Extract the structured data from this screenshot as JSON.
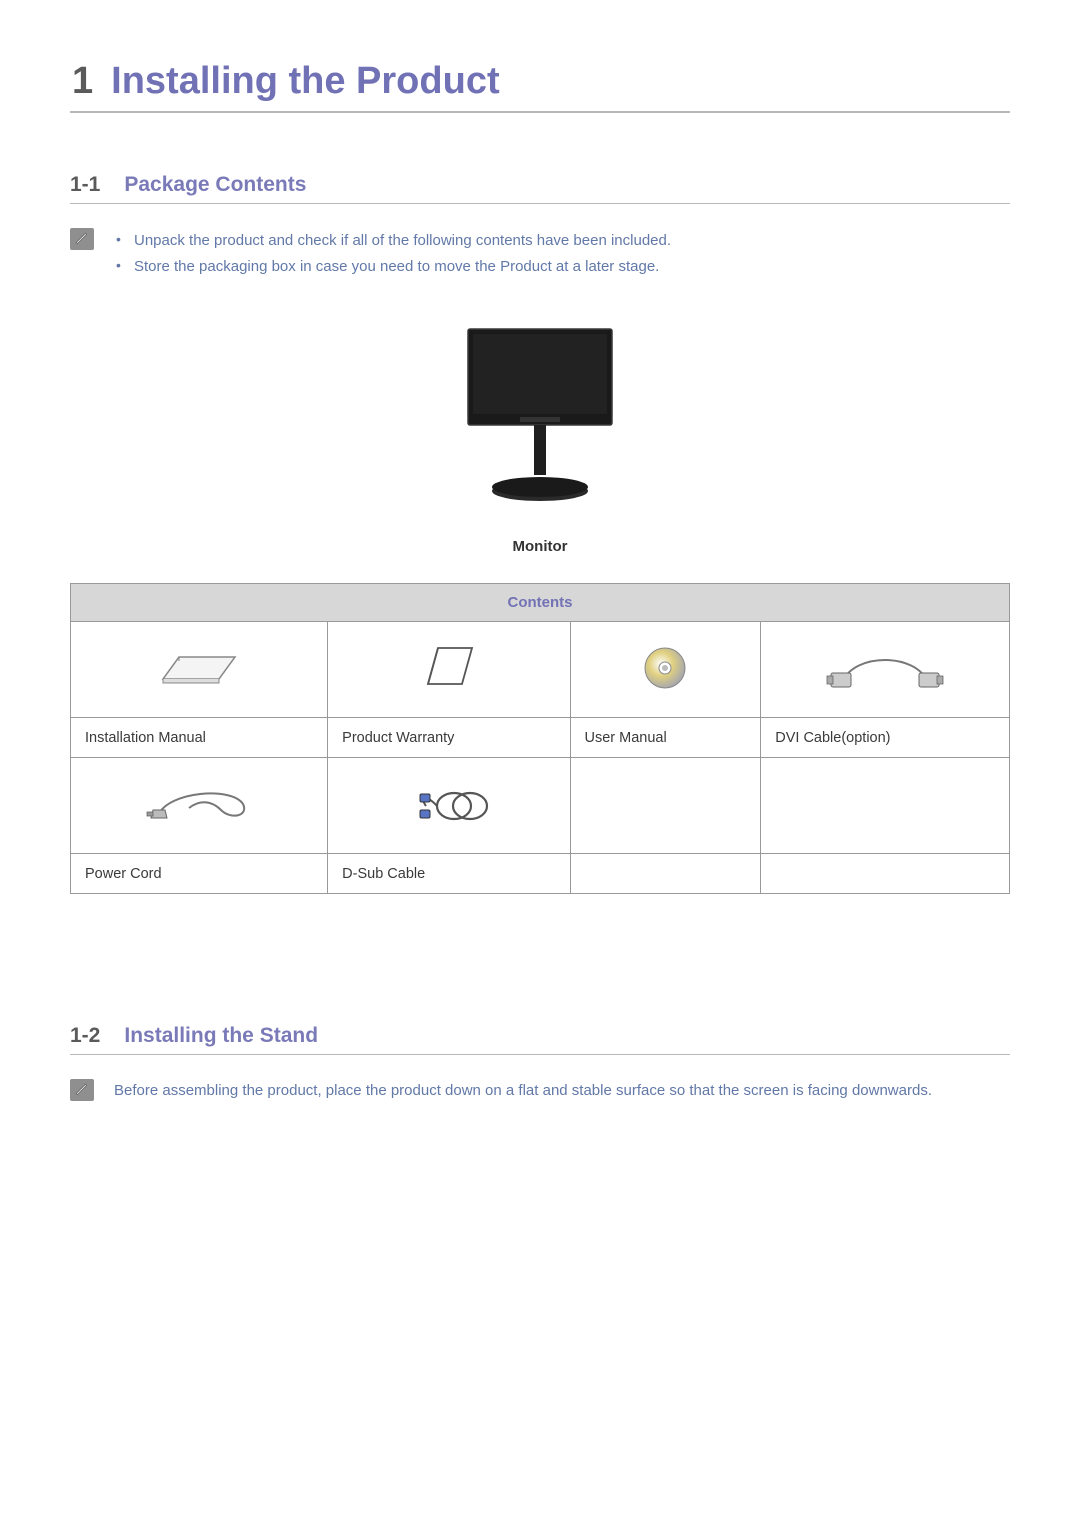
{
  "chapter": {
    "number": "1",
    "title": "Installing the Product"
  },
  "section1": {
    "number": "1-1",
    "title": "Package Contents",
    "notes": [
      "Unpack the product and check if all of the following contents have been included.",
      "Store the packaging box in case you need to move the Product at a later stage."
    ],
    "monitor_label": "Monitor",
    "table_header": "Contents",
    "items_row1": [
      "Installation Manual",
      "Product Warranty",
      "User Manual",
      "DVI Cable(option)"
    ],
    "items_row2": [
      "Power Cord",
      "D-Sub Cable",
      "",
      ""
    ]
  },
  "section2": {
    "number": "1-2",
    "title": "Installing the Stand",
    "note": "Before assembling the product, place the product down on a flat and stable surface so that the screen is facing downwards."
  }
}
